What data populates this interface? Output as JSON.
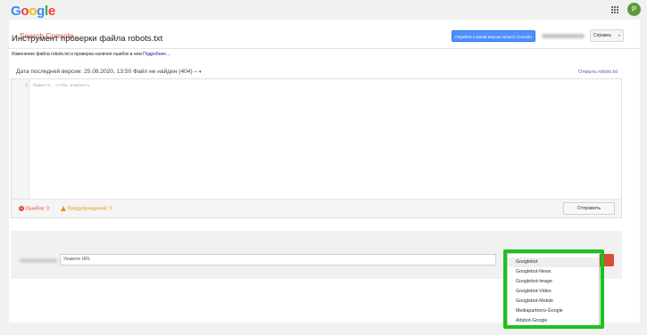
{
  "topbar": {
    "logo_letters": [
      {
        "char": "G",
        "color": "#4285f4"
      },
      {
        "char": "o",
        "color": "#ea4335"
      },
      {
        "char": "o",
        "color": "#fbbc05"
      },
      {
        "char": "g",
        "color": "#4285f4"
      },
      {
        "char": "l",
        "color": "#34a853"
      },
      {
        "char": "e",
        "color": "#ea4335"
      }
    ],
    "avatar_initial": "P",
    "apps_icon": "apps-grid-icon"
  },
  "header": {
    "title": "Search Console",
    "new_version_button": "Перейти к новой версии Search Console",
    "help_button": "Справка",
    "help_caret": "▾"
  },
  "page": {
    "title": "Инструмент проверки файла robots.txt",
    "description": "Изменение файла robots.txt и проверка наличия ошибок в нем",
    "more_link": "Подробнее..."
  },
  "version": {
    "label": "Дата последней версии: 25.08.2020, 13:50 Файл не найден (404) –",
    "caret": "▾",
    "open_link": "Открыть robots.txt"
  },
  "editor": {
    "line_number": "1",
    "placeholder": "Нажмите, чтобы изменить"
  },
  "status": {
    "errors_label": "Ошибок: 0",
    "error_icon": "x",
    "warnings_label": "Предупреждений: 0",
    "send_button": "Отправить"
  },
  "test": {
    "url_placeholder": "Укажите URL",
    "check_button": "ить"
  },
  "dropdown": {
    "items": [
      "Googlebot",
      "Googlebot-News",
      "Googlebot-Image",
      "Googlebot-Video",
      "Googlebot-Mobile",
      "Mediapartners-Google",
      "Adsbot-Google"
    ],
    "selected": "Googlebot",
    "highlight_color": "#1ac31a"
  }
}
